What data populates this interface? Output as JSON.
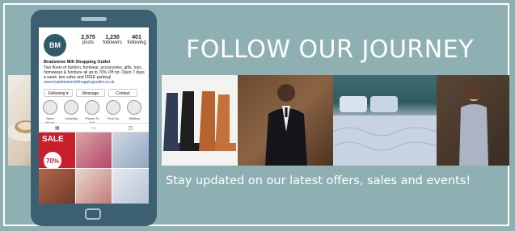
{
  "banner": {
    "headline": "FOLLOW OUR JOURNEY",
    "subline": "Stay updated on our latest offers, sales and events!",
    "background_color": "#8fb0b3"
  },
  "phone": {
    "profile": {
      "avatar_text": "BM",
      "posts_count": "2,575",
      "posts_label": "posts",
      "followers_count": "1,230",
      "followers_label": "followers",
      "following_count": "401",
      "following_label": "following",
      "name": "Bradstone Mill Shopping Outlet",
      "bio": "Two floors of fashion, footwear, accessories, gifts, toys, homeware & furniture all up to 70% Off rrp. Open 7 days a week, two cafes and FREE parking!",
      "link": "www.bradstonemillshoppingoutlet.co.uk"
    },
    "buttons": {
      "following": "Following ▾",
      "message": "Message",
      "contact": "Contact"
    },
    "highlights": [
      "Open Hours",
      "Unfamily",
      "Places To Eat",
      "Find Us",
      "Waiting"
    ],
    "grid_post": {
      "sale_text": "SALE",
      "percent_text": "70%"
    }
  },
  "icons": [
    "grid-icon",
    "tv-icon",
    "tagged-icon"
  ]
}
